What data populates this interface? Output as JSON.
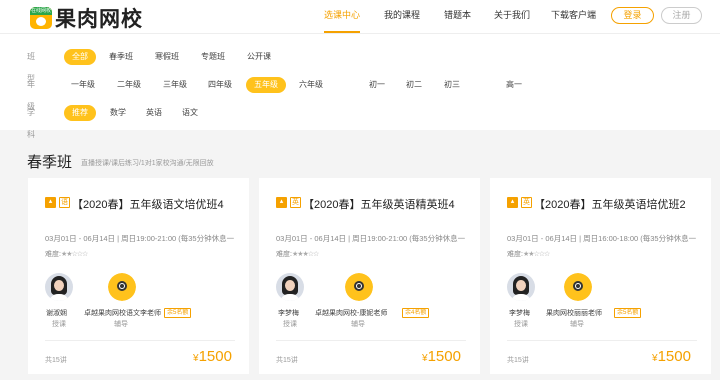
{
  "header": {
    "logo_badge": "在线网校",
    "logo_text": "果肉网校",
    "nav": [
      {
        "label": "选课中心",
        "active": true
      },
      {
        "label": "我的课程",
        "active": false
      },
      {
        "label": "错题本",
        "active": false
      },
      {
        "label": "关于我们",
        "active": false
      },
      {
        "label": "下载客户端",
        "active": false
      }
    ],
    "login": "登录",
    "register": "注册"
  },
  "filters": {
    "class_type": {
      "label": "班型",
      "options": [
        "全部",
        "春季班",
        "寒假班",
        "专题班",
        "公开课"
      ],
      "selected": "全部"
    },
    "grade": {
      "label": "年级",
      "options": [
        "一年级",
        "二年级",
        "三年级",
        "四年级",
        "五年级",
        "六年级",
        "初一",
        "初二",
        "初三",
        "高一"
      ],
      "selected": "五年级"
    },
    "subject": {
      "label": "学科",
      "options": [
        "推荐",
        "数学",
        "英语",
        "语文"
      ],
      "selected": "推荐"
    }
  },
  "section": {
    "title": "春季班",
    "subtitle": "直播授课/课后练习/1对1家校沟通/无限回放"
  },
  "cards": [
    {
      "subject_tag": "语",
      "title": "【2020春】五年级语文培优班4",
      "schedule": "03月01日 - 06月14日 | 周日19:00-21:00 (每35分钟休息一",
      "difficulty_label": "难度:",
      "difficulty_stars": "★★☆☆☆",
      "teacher_name": "谢淑娴",
      "teacher_role": "授课",
      "tutor_name": "卓越果肉网校语文李老师",
      "tutor_role": "辅导",
      "seats": "余5名额",
      "lessons": "共15讲",
      "currency": "¥",
      "price": "1500"
    },
    {
      "subject_tag": "英",
      "title": "【2020春】五年级英语精英班4",
      "schedule": "03月01日 - 06月14日 | 周日19:00-21:00 (每35分钟休息一",
      "difficulty_label": "难度:",
      "difficulty_stars": "★★★☆☆",
      "teacher_name": "李梦梅",
      "teacher_role": "授课",
      "tutor_name": "卓越果肉网校-康妮老师",
      "tutor_role": "辅导",
      "seats": "余4名额",
      "lessons": "共15讲",
      "currency": "¥",
      "price": "1500"
    },
    {
      "subject_tag": "英",
      "title": "【2020春】五年级英语培优班2",
      "schedule": "03月01日 - 06月14日 | 周日16:00-18:00 (每35分钟休息一",
      "difficulty_label": "难度:",
      "difficulty_stars": "★★☆☆☆",
      "teacher_name": "李梦梅",
      "teacher_role": "授课",
      "tutor_name": "果肉网校丽丽老师",
      "tutor_role": "辅导",
      "seats": "余5名额",
      "lessons": "共15讲",
      "currency": "¥",
      "price": "1500"
    }
  ]
}
